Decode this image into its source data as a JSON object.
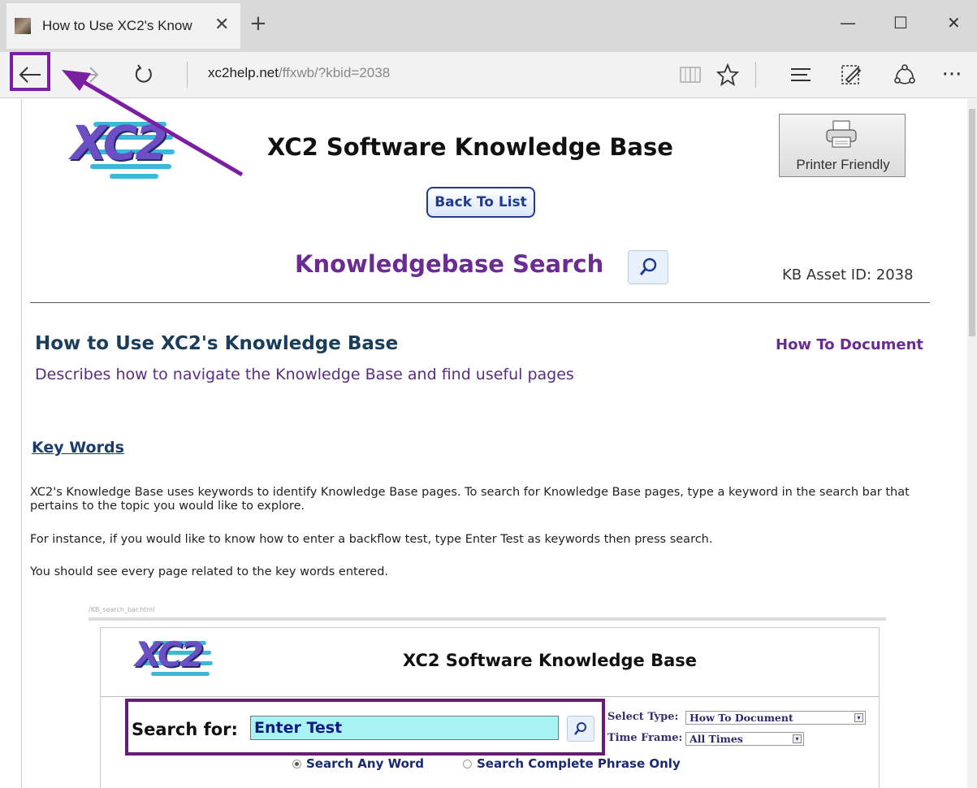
{
  "browser": {
    "tab_title": "How to Use XC2's Know",
    "tab_close": "✕",
    "new_tab": "+",
    "window": {
      "minimize": "—",
      "maximize": "☐",
      "close": "✕"
    },
    "url_host": "xc2help.net",
    "url_path": "/ffxwb/?kbid=2038",
    "more": "···"
  },
  "page": {
    "logo_text": "XC2",
    "title": "XC2 Software Knowledge Base",
    "printer_button": "Printer Friendly",
    "back_button": "Back To List",
    "search_heading": "Knowledgebase Search",
    "asset_id": "KB Asset ID:  2038",
    "doc_title": "How to Use XC2's Knowledge Base",
    "doc_type": "How To Document",
    "doc_description": "Describes how to navigate the Knowledge Base and find useful pages",
    "section_heading": "Key Words",
    "paragraphs": [
      "XC2's Knowledge Base uses keywords to identify Knowledge Base pages. To search for Knowledge Base pages, type a keyword in the search bar that pertains to the topic you would like to explore.",
      "For instance, if you would like to know how to enter a backflow test, type Enter Test as keywords then press search.",
      "You should see every page related to the key words entered."
    ]
  },
  "screenshot": {
    "caption": "/KB_search_bar.html",
    "logo_text": "XC2",
    "title": "XC2 Software Knowledge Base",
    "search_label": "Search for:",
    "search_value": "Enter Test",
    "select_type_label": "Select Type:",
    "select_type_value": "How To Document",
    "time_frame_label": "Time Frame:",
    "time_frame_value": "All Times",
    "radio_any": "Search Any Word",
    "radio_phrase": "Search Complete Phrase Only"
  },
  "colors": {
    "annotation": "#7b1fa2",
    "heading_purple": "#6a2c91",
    "search_field": "#a8f4f4"
  }
}
